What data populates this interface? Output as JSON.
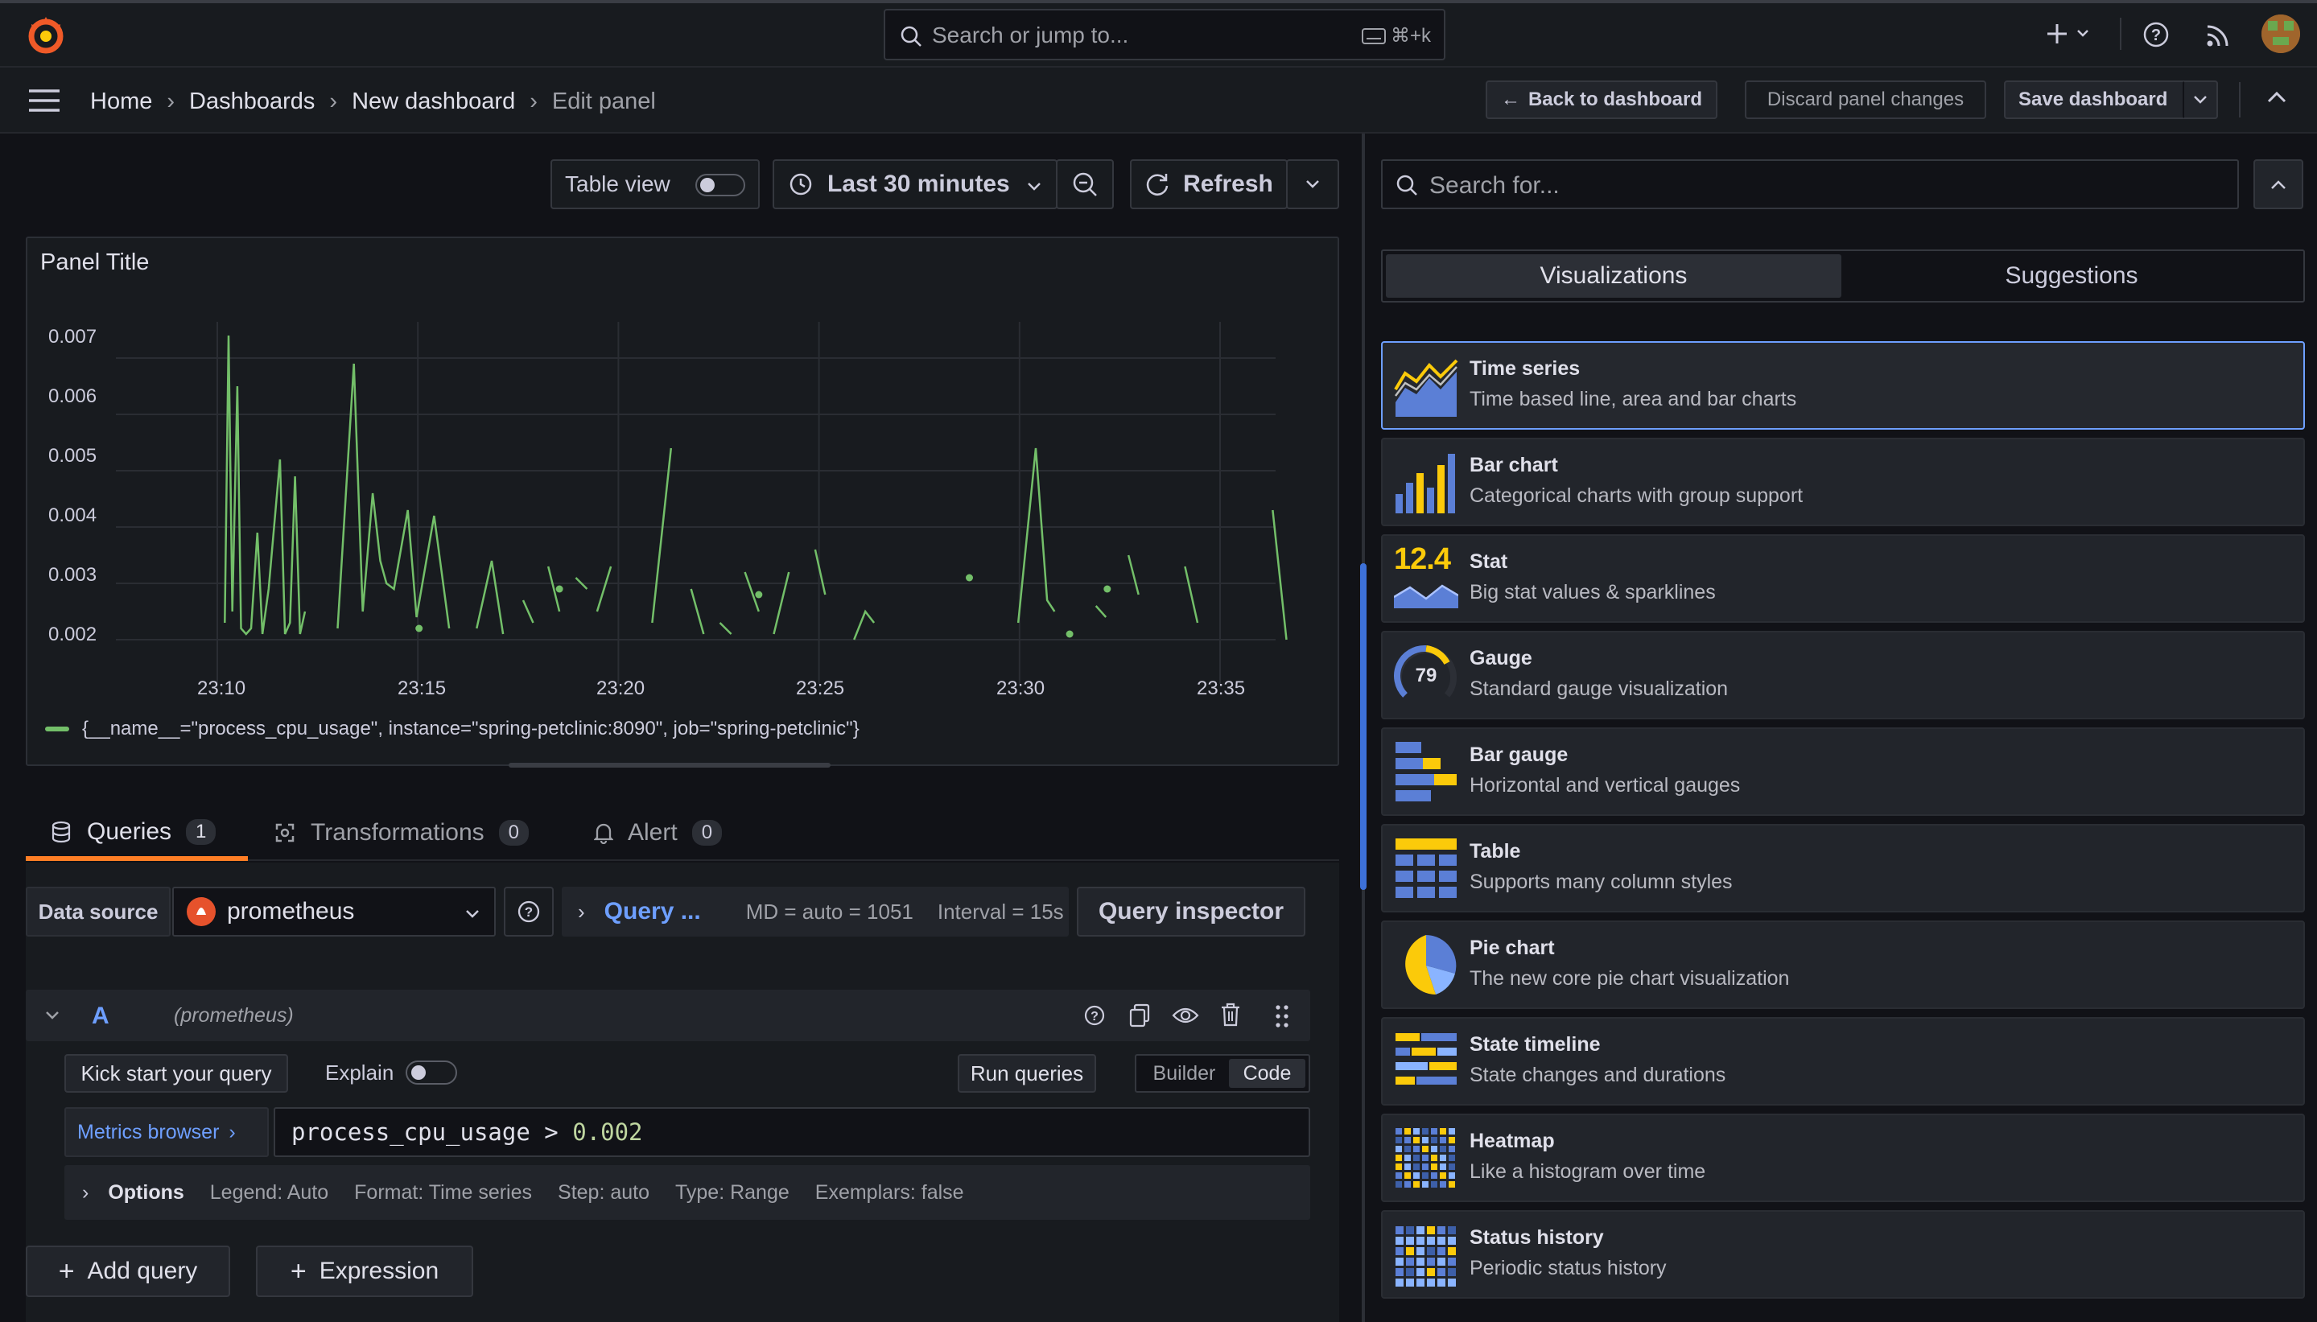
{
  "topbar": {
    "search_placeholder": "Search or jump to...",
    "shortcut": "⌘+k"
  },
  "breadcrumb": [
    "Home",
    "Dashboards",
    "New dashboard",
    "Edit panel"
  ],
  "header_actions": {
    "back": "Back to dashboard",
    "discard": "Discard panel changes",
    "save": "Save dashboard"
  },
  "toolbar": {
    "table_view": "Table view",
    "time_range": "Last 30 minutes",
    "refresh": "Refresh"
  },
  "panel": {
    "title": "Panel Title",
    "legend": "{__name__=\"process_cpu_usage\", instance=\"spring-petclinic:8090\", job=\"spring-petclinic\"}"
  },
  "chart_data": {
    "type": "line",
    "y_ticks": [
      "0.007",
      "0.006",
      "0.005",
      "0.004",
      "0.003",
      "0.002"
    ],
    "x_ticks": [
      "23:10",
      "23:15",
      "23:20",
      "23:25",
      "23:30",
      "23:35"
    ],
    "ylim": [
      0.0015,
      0.0075
    ],
    "series_color": "#73bf69",
    "series": [
      {
        "segments": [
          [
            [
              23.075,
              0.0023
            ],
            [
              23.112,
              0.0074
            ],
            [
              23.15,
              0.0025
            ],
            [
              23.2,
              0.0065
            ],
            [
              23.237,
              0.0022
            ],
            [
              23.287,
              0.0021
            ],
            [
              23.337,
              0.0022
            ],
            [
              23.4,
              0.0039
            ],
            [
              23.45,
              0.0021
            ],
            [
              23.512,
              0.0029
            ],
            [
              23.625,
              0.0052
            ],
            [
              23.675,
              0.0021
            ],
            [
              23.725,
              0.0023
            ],
            [
              23.775,
              0.0049
            ],
            [
              23.825,
              0.0021
            ],
            [
              23.875,
              0.0025
            ]
          ],
          [
            [
              24.2,
              0.0022
            ],
            [
              24.362,
              0.0069
            ],
            [
              24.45,
              0.0025
            ],
            [
              24.55,
              0.0046
            ],
            [
              24.625,
              0.0034
            ],
            [
              24.687,
              0.003
            ],
            [
              24.762,
              0.0029
            ],
            [
              24.9,
              0.0043
            ],
            [
              24.987,
              0.0024
            ],
            [
              25.162,
              0.0042
            ],
            [
              25.312,
              0.0022
            ]
          ],
          [
            [
              25.587,
              0.0022
            ],
            [
              25.737,
              0.0034
            ],
            [
              25.85,
              0.0021
            ]
          ],
          [
            [
              26.05,
              0.0027
            ],
            [
              26.15,
              0.0023
            ]
          ],
          [
            [
              26.3,
              0.0033
            ],
            [
              26.412,
              0.0025
            ]
          ],
          [
            [
              26.575,
              0.0031
            ],
            [
              26.687,
              0.0029
            ]
          ],
          [
            [
              26.787,
              0.0025
            ],
            [
              26.925,
              0.0033
            ]
          ],
          [
            [
              27.337,
              0.0023
            ],
            [
              27.525,
              0.0054
            ]
          ],
          [
            [
              27.725,
              0.0029
            ],
            [
              27.85,
              0.0021
            ]
          ],
          [
            [
              28.012,
              0.0023
            ],
            [
              28.125,
              0.0021
            ]
          ],
          [
            [
              28.262,
              0.0032
            ],
            [
              28.4,
              0.0025
            ]
          ],
          [
            [
              28.55,
              0.0021
            ],
            [
              28.7,
              0.0032
            ]
          ],
          [
            [
              28.962,
              0.0036
            ],
            [
              29.062,
              0.0028
            ]
          ],
          [
            [
              29.35,
              0.002
            ],
            [
              29.462,
              0.0025
            ],
            [
              29.55,
              0.0023
            ]
          ],
          [
            [
              30.987,
              0.0023
            ],
            [
              31.162,
              0.0054
            ],
            [
              31.275,
              0.0027
            ],
            [
              31.35,
              0.0025
            ]
          ],
          [
            [
              31.762,
              0.0026
            ],
            [
              31.862,
              0.0024
            ]
          ],
          [
            [
              32.087,
              0.0035
            ],
            [
              32.187,
              0.0028
            ]
          ],
          [
            [
              32.65,
              0.0033
            ],
            [
              32.775,
              0.0023
            ]
          ],
          [
            [
              33.525,
              0.0043
            ],
            [
              33.662,
              0.002
            ]
          ]
        ],
        "points": [
          [
            25.012,
            0.0022
          ],
          [
            26.412,
            0.0029
          ],
          [
            28.4,
            0.0028
          ],
          [
            30.5,
            0.0031
          ],
          [
            31.5,
            0.0021
          ],
          [
            31.875,
            0.0029
          ]
        ]
      }
    ]
  },
  "tabs": [
    {
      "label": "Queries",
      "count": "1"
    },
    {
      "label": "Transformations",
      "count": "0"
    },
    {
      "label": "Alert",
      "count": "0"
    }
  ],
  "query_bar": {
    "datasource_label": "Data source",
    "datasource": "prometheus",
    "query_options": "Query ...",
    "md": "MD = auto = 1051",
    "interval": "Interval = 15s",
    "inspector": "Query inspector"
  },
  "query_row": {
    "ref": "A",
    "source": "(prometheus)",
    "kick_start": "Kick start your query",
    "explain": "Explain",
    "run": "Run queries",
    "builder": "Builder",
    "code": "Code",
    "metrics_browser": "Metrics browser",
    "expr_metric": "process_cpu_usage",
    "expr_op": " > ",
    "expr_value": "0.002",
    "options_label": "Options",
    "options": {
      "legend": "Legend: Auto",
      "format": "Format: Time series",
      "step": "Step: auto",
      "type": "Type: Range",
      "exemplars": "Exemplars: false"
    }
  },
  "bottom_buttons": {
    "add_query": "Add query",
    "expression": "Expression"
  },
  "right_pane": {
    "search_placeholder": "Search for...",
    "tab_visualizations": "Visualizations",
    "tab_suggestions": "Suggestions",
    "items": [
      {
        "title": "Time series",
        "desc": "Time based line, area and bar charts",
        "icon": "time-series-icon"
      },
      {
        "title": "Bar chart",
        "desc": "Categorical charts with group support",
        "icon": "bar-chart-icon"
      },
      {
        "title": "Stat",
        "desc": "Big stat values & sparklines",
        "icon": "stat-icon"
      },
      {
        "title": "Gauge",
        "desc": "Standard gauge visualization",
        "icon": "gauge-icon"
      },
      {
        "title": "Bar gauge",
        "desc": "Horizontal and vertical gauges",
        "icon": "bar-gauge-icon"
      },
      {
        "title": "Table",
        "desc": "Supports many column styles",
        "icon": "table-icon"
      },
      {
        "title": "Pie chart",
        "desc": "The new core pie chart visualization",
        "icon": "pie-chart-icon"
      },
      {
        "title": "State timeline",
        "desc": "State changes and durations",
        "icon": "state-timeline-icon"
      },
      {
        "title": "Heatmap",
        "desc": "Like a histogram over time",
        "icon": "heatmap-icon"
      },
      {
        "title": "Status history",
        "desc": "Periodic status history",
        "icon": "status-history-icon"
      }
    ],
    "stat_value": "12.4",
    "gauge_value": "79"
  },
  "colors": {
    "accent": "#ff7e25",
    "blue": "#6e9fff",
    "series": "#73bf69",
    "bg": "#111217",
    "panel": "#181b1f"
  }
}
